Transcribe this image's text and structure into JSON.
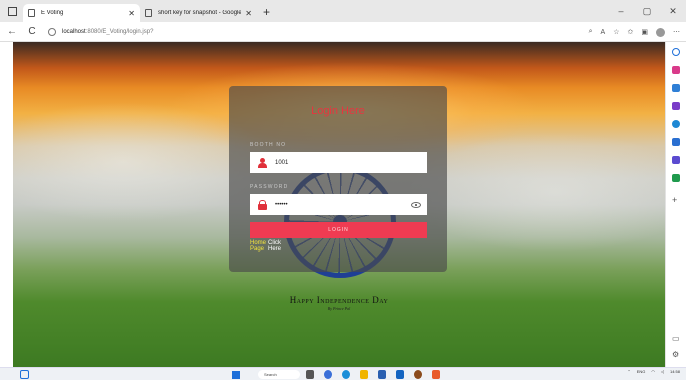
{
  "browser": {
    "tabs": [
      {
        "title": "E Voting",
        "active": true
      },
      {
        "title": "short key for snapshot - Google",
        "active": false
      }
    ],
    "new_tab": "+",
    "window_controls": [
      "–",
      "▢",
      "✕"
    ],
    "url_host": "localhost",
    "url_path": ":8080/E_Voting/login.jsp?",
    "nav": {
      "back": "←",
      "reload": "C"
    }
  },
  "login": {
    "title": "Login Here",
    "booth_label": "BOOTH NO",
    "booth_value": "1001",
    "password_label": "PASSWORD",
    "password_value": "••••••",
    "button": "LOGIN",
    "home_link": "Home Page",
    "click_link": "Click Here"
  },
  "banner": {
    "title": "Happy Independence Day",
    "subtitle": "By Prince Pal"
  },
  "taskbar": {
    "search": "Search",
    "lang": "ENG",
    "time": "14:58"
  },
  "colors": {
    "accent_red": "#ef3b52",
    "title_red": "#e8353f",
    "link_yellow": "#f2e33c",
    "chakra_blue": "#1f3f95"
  }
}
